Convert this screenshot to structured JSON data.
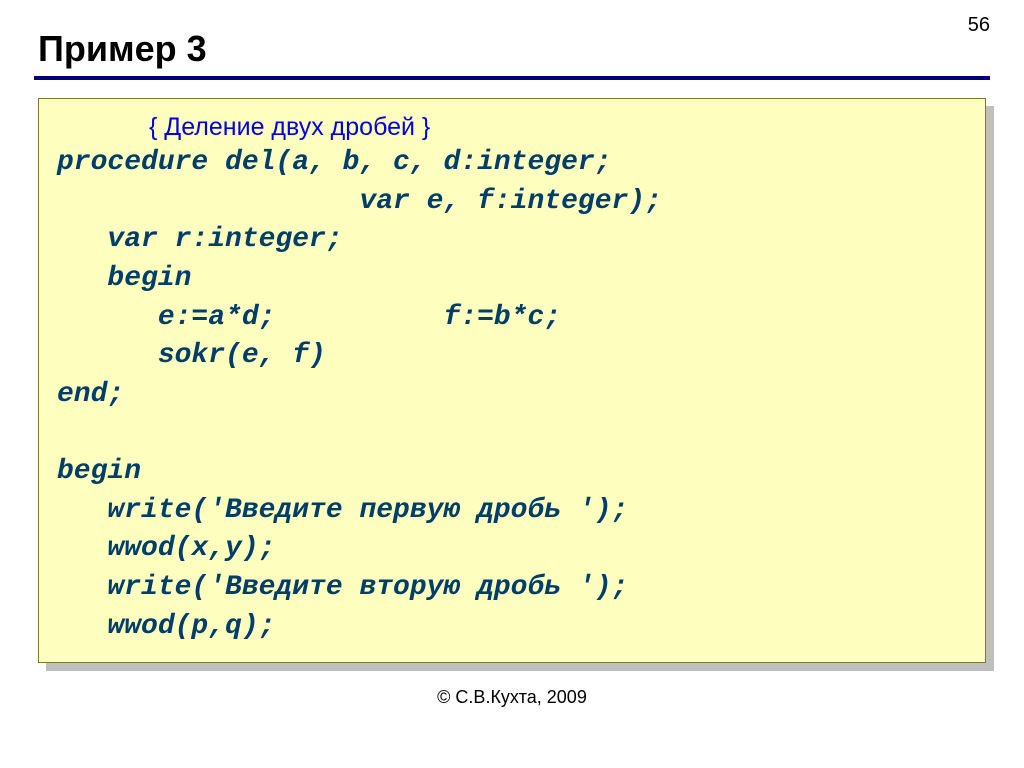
{
  "page_number": "56",
  "title": "Пример 3",
  "comment": "{ Деление двух дробей }",
  "code": "procedure del(a, b, c, d:integer;\n                  var e, f:integer);\n   var r:integer;\n   begin\n      e:=a*d;          f:=b*c;\n      sokr(e, f)\nend;\n\nbegin\n   write('Введите первую дробь ');\n   wwod(x,y);\n   write('Введите вторую дробь ');\n   wwod(p,q);",
  "footer": "© С.В.Кухта, 2009"
}
